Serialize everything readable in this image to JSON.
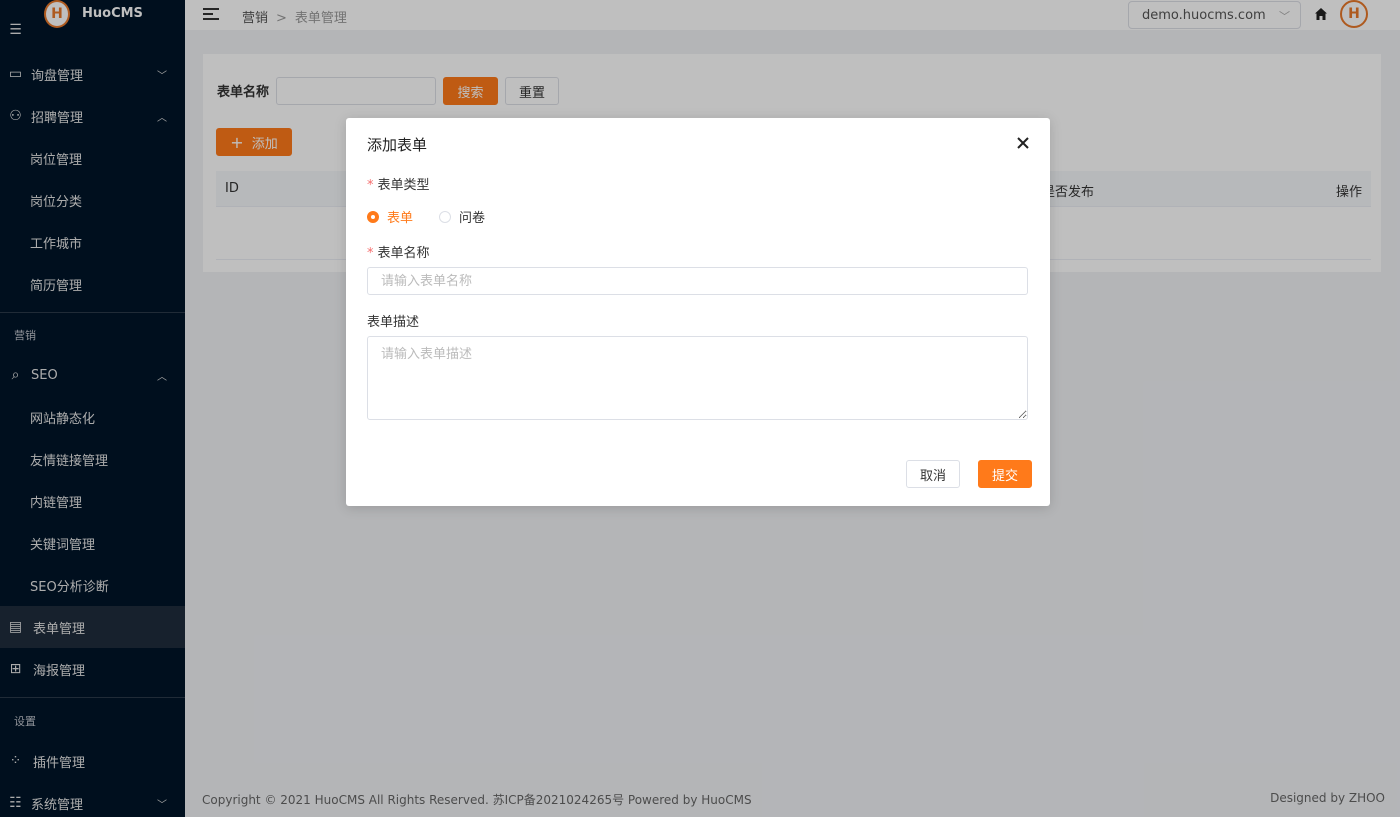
{
  "app": {
    "name": "HuoCMS"
  },
  "sidebar": {
    "top_items": [
      {
        "label": "询盘管理",
        "icon": "inquiry-icon"
      },
      {
        "label": "招聘管理",
        "icon": "user-icon"
      }
    ],
    "recruit_sub": [
      "岗位管理",
      "岗位分类",
      "工作城市",
      "简历管理"
    ],
    "group_marketing": "营销",
    "seo": {
      "label": "SEO",
      "icon": "search-icon"
    },
    "seo_sub": [
      "网站静态化",
      "友情链接管理",
      "内链管理",
      "关键词管理",
      "SEO分析诊断"
    ],
    "form_mgmt": "表单管理",
    "poster_mgmt": "海报管理",
    "group_settings": "设置",
    "plugin_mgmt": "插件管理",
    "system_mgmt": "系统管理"
  },
  "header": {
    "breadcrumb": [
      "营销",
      "表单管理"
    ],
    "breadcrumb_sep": ">",
    "site": "demo.huocms.com"
  },
  "query": {
    "label": "表单名称",
    "input_value": "",
    "search_button": "搜索",
    "reset_button": "重置",
    "add_button": "添加"
  },
  "table": {
    "columns": {
      "id": "ID",
      "published": "是否发布",
      "actions": "操作"
    }
  },
  "modal": {
    "title": "添加表单",
    "type_label": "表单类型",
    "type_options": [
      "表单",
      "问卷"
    ],
    "type_selected": "表单",
    "name_label": "表单名称",
    "name_placeholder": "请输入表单名称",
    "desc_label": "表单描述",
    "desc_placeholder": "请输入表单描述",
    "cancel": "取消",
    "submit": "提交"
  },
  "footer": {
    "copyright": "Copyright © 2021 HuoCMS All Rights Reserved. 苏ICP备2021024265号 Powered by HuoCMS",
    "designed": "Designed by ZHOO"
  },
  "colors": {
    "accent": "#ff7a1a",
    "sidebar_bg": "#001529"
  }
}
